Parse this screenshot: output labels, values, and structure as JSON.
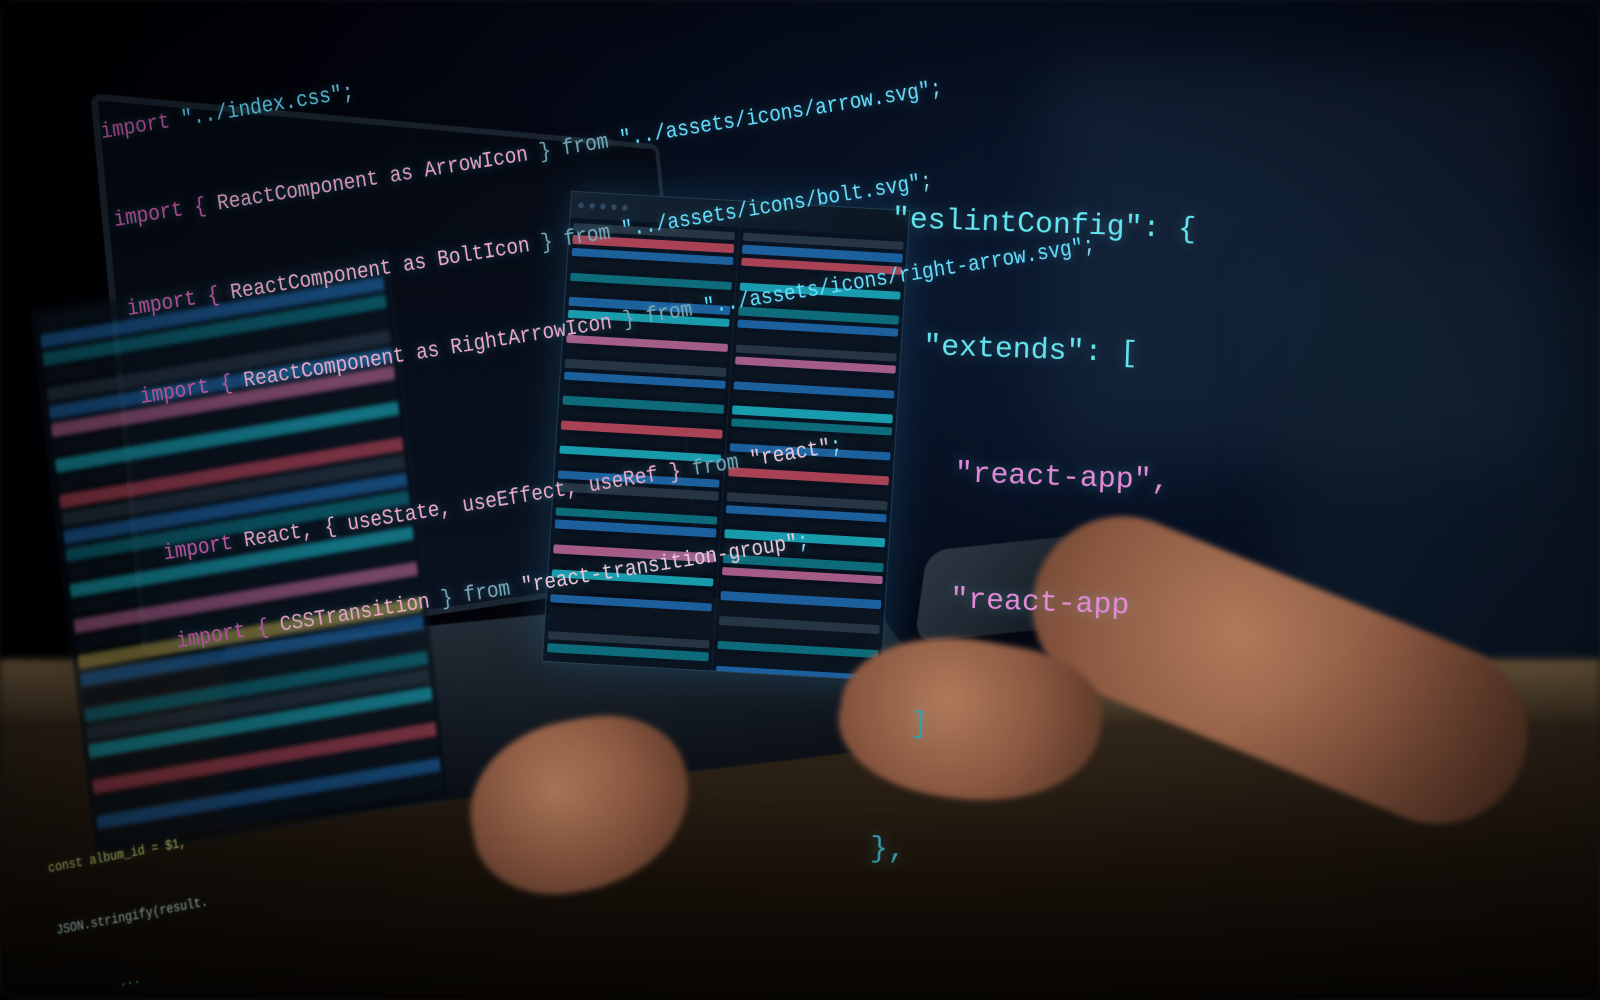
{
  "hero_code": {
    "l1": {
      "kw": "import ",
      "str": "\"../index.css\"",
      "end": ";"
    },
    "l2": {
      "kw": "import { ",
      "name": "ReactComponent as ArrowIcon",
      "mid": " } from ",
      "str": "\"../assets/icons/arrow.svg\"",
      "end": ";"
    },
    "l3": {
      "kw": "import { ",
      "name": "ReactComponent as BoltIcon",
      "mid": " } from ",
      "str": "\"../assets/icons/bolt.svg\"",
      "end": ";"
    },
    "l4": {
      "kw": "import { ",
      "name": "ReactComponent as RightArrowIcon",
      "mid": " } from ",
      "str": "\"../assets/icons/right-arrow.svg\"",
      "end": ";"
    },
    "l5": {
      "kw": "import ",
      "name": "React, { useState, useEffect, useRef }",
      "mid": " from ",
      "str": "\"react\"",
      "end": ";"
    },
    "l6": {
      "kw": "import { ",
      "name": "CSSTransition",
      "mid": " } from ",
      "str": "\"react-transition-group\"",
      "end": ";"
    }
  },
  "json_block": {
    "l1": "\"eslintConfig\": {",
    "l2": "  \"extends\": [",
    "l3": "    \"react-app\",",
    "l4": "    \"react-app",
    "l5": "  ]",
    "l6": "},"
  },
  "terminal": {
    "l1": "const album_id = $1,",
    "l2": "JSON.stringify(result.",
    "l3": "        ..."
  }
}
